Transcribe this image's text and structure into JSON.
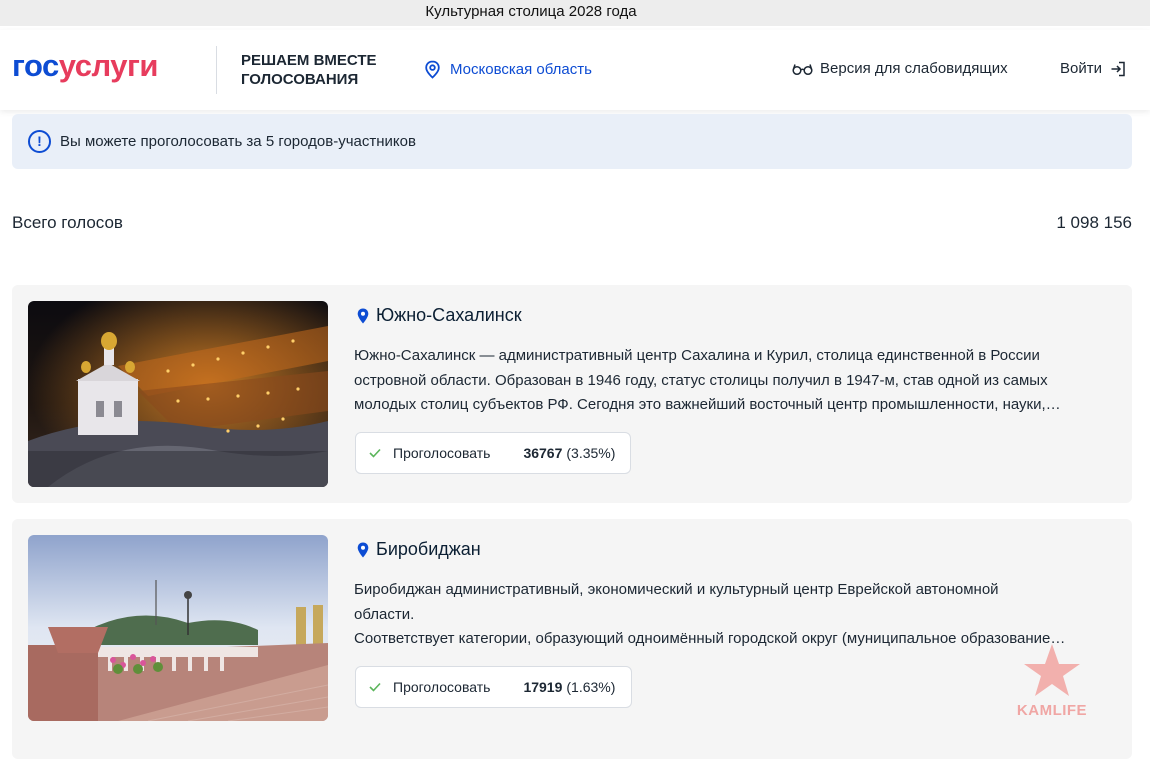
{
  "topbar": {
    "title": "Культурная столица 2028 года"
  },
  "header": {
    "logo": {
      "part1": "гос",
      "part2": "услуги"
    },
    "project_line1": "РЕШАЕМ ВМЕСТЕ",
    "project_line2": "ГОЛОСОВАНИЯ",
    "region": "Московская область",
    "vision_label": "Версия для слабовидящих",
    "login_label": "Войти"
  },
  "notice": {
    "text": "Вы можете проголосовать за 5 городов-участников"
  },
  "total": {
    "label": "Всего голосов",
    "value": "1 098 156"
  },
  "cards": [
    {
      "city": "Южно-Сахалинск",
      "desc": [
        "Южно-Сахалинск — административный центр Сахалина и Курил, столица единственной в России",
        "островной области. Образован в 1946 году, статус столицы получил в 1947-м, став одной из самых",
        "молодых столиц субъектов РФ. Сегодня это важнейший восточный центр промышленности, науки,…"
      ],
      "vote_label": "Проголосовать",
      "votes": "36767",
      "percent": "(3.35%)"
    },
    {
      "city": "Биробиджан",
      "desc": [
        "Биробиджан административный, экономический и культурный центр Еврейской автономной",
        "области.",
        "Соответствует категории, образующий одноимённый городской округ (муниципальное образование…"
      ],
      "vote_label": "Проголосовать",
      "votes": "17919",
      "percent": "(1.63%)"
    }
  ],
  "watermark": {
    "text": "KAMLIFE"
  },
  "colors": {
    "brand_blue": "#0d4cd3",
    "brand_red": "#e73c5d",
    "check_green": "#5bb55b",
    "notice_bg": "#e9eff8"
  },
  "icons": [
    "location-pin-icon",
    "glasses-icon",
    "login-arrow-icon",
    "info-icon",
    "check-icon",
    "star-icon"
  ]
}
